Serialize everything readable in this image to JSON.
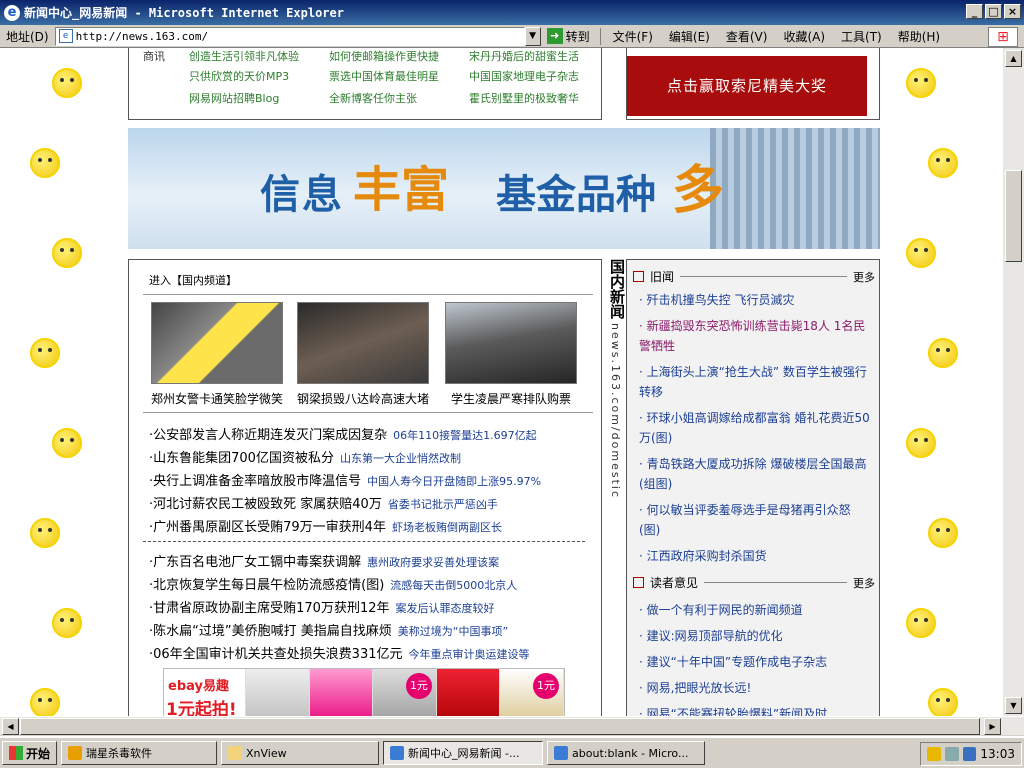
{
  "window": {
    "title": "新闻中心_网易新闻 - Microsoft Internet Explorer",
    "minimize": "_",
    "maximize": "□",
    "close": "×"
  },
  "address_bar": {
    "label": "地址(D)",
    "url": "http://news.163.com/",
    "go_label": "转到"
  },
  "menu": [
    "文件(F)",
    "编辑(E)",
    "查看(V)",
    "收藏(A)",
    "工具(T)",
    "帮助(H)"
  ],
  "top_links": {
    "category": "商讯",
    "rows": [
      [
        "创造生活引领非凡体验",
        "如何使邮箱操作更快捷",
        "宋丹丹婚后的甜蜜生活"
      ],
      [
        "只供欣赏的天价MP3",
        "票选中国体育最佳明星",
        "中国国家地理电子杂志"
      ],
      [
        "网易网站招聘Blog",
        "全新博客任你主张",
        "霍氏别墅里的极致奢华"
      ]
    ]
  },
  "promo": {
    "text": "点击赢取索尼精美大奖"
  },
  "banner": {
    "text1": "信息",
    "text2": "丰富",
    "text3": "基金品种",
    "text4": "多"
  },
  "main": {
    "enter_label": "进入【国内频道】",
    "photos": [
      {
        "caption": "郑州女警卡通笑脸学微笑"
      },
      {
        "caption": "钢梁损毁八达岭高速大堵"
      },
      {
        "caption": "学生凌晨严寒排队购票"
      }
    ],
    "news_group1": [
      {
        "title": "公安部发言人称近期连发灭门案成因复杂",
        "sub": "06年110接警量达1.697亿起"
      },
      {
        "title": "山东鲁能集团700亿国资被私分",
        "sub": "山东第一大企业悄然改制"
      },
      {
        "title": "央行上调准备金率暗放股市降温信号",
        "sub": "中国人寿今日开盘随即上涨95.97%"
      },
      {
        "title": "河北讨薪农民工被殴致死 家属获赔40万",
        "sub": "省委书记批示严惩凶手"
      },
      {
        "title": "广州番禺原副区长受贿79万一审获刑4年",
        "sub": "虾场老板贿倒两副区长"
      }
    ],
    "news_group2": [
      {
        "title": "广东百名电池厂女工镉中毒案获调解",
        "sub": "惠州政府要求妥善处理该案"
      },
      {
        "title": "北京恢复学生每日晨午检防流感疫情(图)",
        "sub": "流感每天击倒5000北京人"
      },
      {
        "title": "甘肃省原政协副主席受贿170万获刑12年",
        "sub": "案发后认罪态度较好"
      },
      {
        "title": "陈水扁“过境”美侨胞喊打 美指扁自找麻烦",
        "sub": "美称过境为“中国事项”"
      },
      {
        "title": "06年全国审计机关共查处损失浪费331亿元",
        "sub": "今年重点审计奥运建设等"
      }
    ],
    "ad": {
      "brand": "ebay易趣",
      "headline": "1元起拍!",
      "price1": "1元",
      "price2": "1元"
    }
  },
  "vertical_label": {
    "title": "国内新闻",
    "url": "news.163.com/domestic"
  },
  "sidebar": {
    "old_news": {
      "header": "旧闻",
      "more": "更多",
      "items": [
        {
          "text": "歼击机撞鸟失控 飞行员滅灾",
          "highlight": false
        },
        {
          "text": "新疆捣毁东突恐怖训练营击毙18人 1名民警牺牲",
          "highlight": true
        },
        {
          "text": "上海街头上演“抢生大战” 数百学生被强行转移",
          "highlight": false
        },
        {
          "text": "环球小姐高调嫁给成都富翁 婚礼花费近50万(图)",
          "highlight": false
        },
        {
          "text": "青岛铁路大厦成功拆除 爆破楼层全国最高(组图)",
          "highlight": false
        },
        {
          "text": "何以敏当评委羞辱选手是母猪再引众怒(图)",
          "highlight": false
        },
        {
          "text": "江西政府采购封杀国货",
          "highlight": false
        }
      ]
    },
    "readers": {
      "header": "读者意见",
      "more": "更多",
      "items": [
        {
          "text": "做一个有利于网民的新闻频道"
        },
        {
          "text": "建议:网易顶部导航的优化"
        },
        {
          "text": "建议“十年中国”专题作成电子杂志"
        },
        {
          "text": "网易,把眼光放长远!"
        },
        {
          "text": "网易“不能赛扭轮胎爆料”新闻及时"
        }
      ]
    }
  },
  "taskbar": {
    "start": "开始",
    "tasks": [
      "瑞星杀毒软件",
      "XnView",
      "新闻中心_网易新闻 -...",
      "about:blank - Micro..."
    ],
    "clock": "13:03"
  }
}
